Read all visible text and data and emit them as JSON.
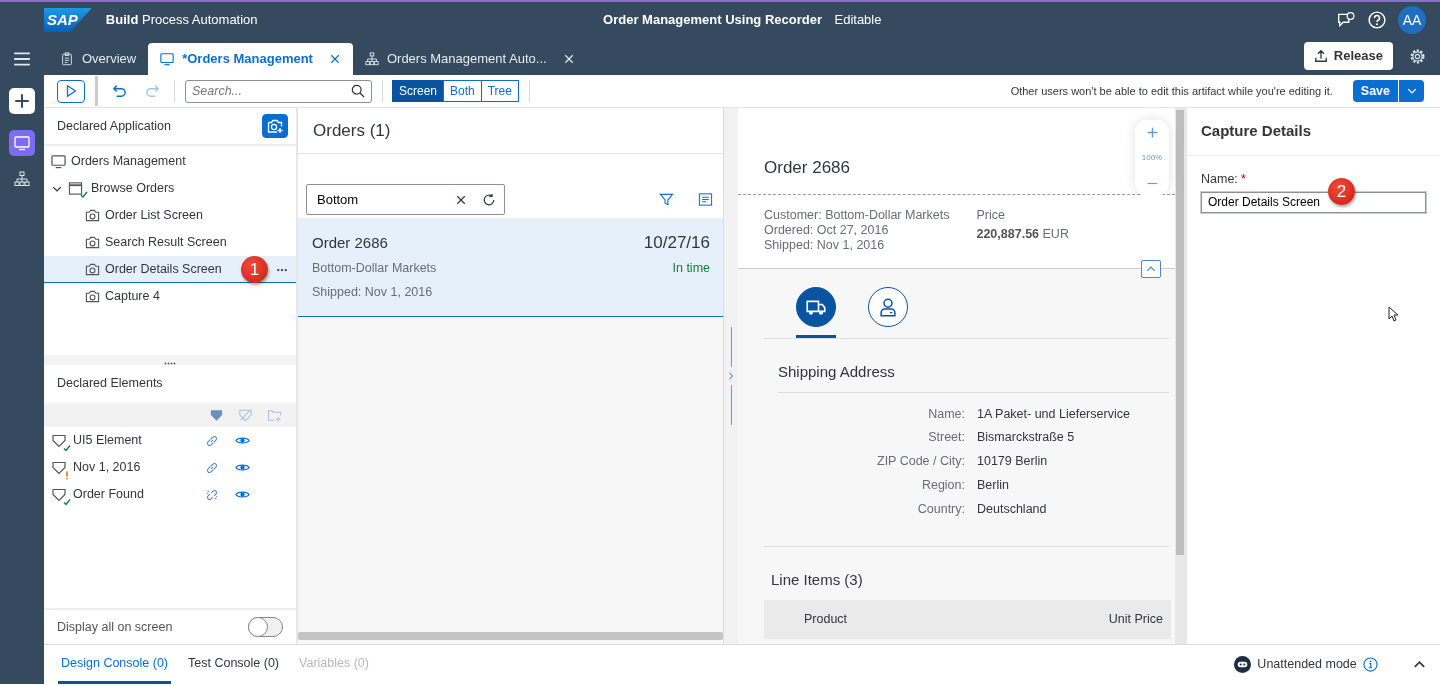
{
  "shell": {
    "logo": "SAP",
    "product_bold": "Build",
    "product": "Process Automation",
    "title": "Order Management Using Recorder",
    "state": "Editable",
    "avatar": "AA"
  },
  "tabs": [
    {
      "label": "Overview",
      "selected": false,
      "closable": false
    },
    {
      "label": "*Orders Management",
      "selected": true,
      "closable": true
    },
    {
      "label": "Orders Management Auto...",
      "selected": false,
      "closable": true
    }
  ],
  "release_button": "Release",
  "rail": [
    {
      "selected": true
    },
    {
      "selected": false
    }
  ],
  "toolbar": {
    "redo_disabled": true,
    "search_placeholder": "Search...",
    "view_modes": [
      {
        "label": "Screen",
        "selected": true
      },
      {
        "label": "Both",
        "selected": false
      },
      {
        "label": "Tree",
        "selected": false
      }
    ],
    "notice": "Other users won't be able to edit this artifact while you're editing it.",
    "save_button": "Save"
  },
  "declared_application": {
    "title": "Declared Application",
    "tree": [
      {
        "label": "Orders Management",
        "kind": "application",
        "selected": false
      },
      {
        "label": "Browse Orders",
        "kind": "page",
        "validated": true,
        "expanded": true,
        "selected": false,
        "children": [
          {
            "label": "Order List Screen",
            "kind": "screen",
            "selected": false
          },
          {
            "label": "Search Result Screen",
            "kind": "screen",
            "selected": false
          },
          {
            "label": "Order Details Screen",
            "kind": "screen",
            "selected": true,
            "marker": "1"
          },
          {
            "label": "Capture 4",
            "kind": "screen",
            "selected": false
          }
        ]
      }
    ]
  },
  "declared_elements": {
    "title": "Declared Elements",
    "rows": [
      {
        "label": "UI5 Element",
        "warning": false,
        "broken_link": false
      },
      {
        "label": "Nov 1, 2016",
        "warning": true,
        "broken_link": false
      },
      {
        "label": "Order Found",
        "warning": false,
        "broken_link": true
      }
    ]
  },
  "display_all": {
    "label": "Display all on screen",
    "on": false
  },
  "orders": {
    "title": "Orders (1)",
    "search_value": "Bottom",
    "items": [
      {
        "title": "Order 2686",
        "date": "10/27/16",
        "customer": "Bottom-Dollar Markets",
        "status": "In time",
        "shipped": "Shipped: Nov 1, 2016",
        "selected": true
      }
    ]
  },
  "detail": {
    "title": "Order 2686",
    "zoom": "100%",
    "customer": "Customer: Bottom-Dollar Markets",
    "ordered": "Ordered: Oct 27, 2016",
    "shipped": "Shipped: Nov 1, 2016",
    "price_label": "Price",
    "price_value": "220,887.56",
    "currency": "EUR",
    "icon_tabs": [
      {
        "selected": true
      },
      {
        "selected": false
      }
    ],
    "section_title": "Shipping Address",
    "fields": [
      {
        "label": "Name:",
        "value": "1A Paket- und Lieferservice"
      },
      {
        "label": "Street:",
        "value": "Bismarckstraße 5"
      },
      {
        "label": "ZIP Code / City:",
        "value": "10179 Berlin"
      },
      {
        "label": "Region:",
        "value": "Berlin"
      },
      {
        "label": "Country:",
        "value": "Deutschland"
      }
    ],
    "line_items_title": "Line Items (3)",
    "columns": [
      "Product",
      "Unit Price"
    ]
  },
  "capture": {
    "title": "Capture Details",
    "label": "Name:",
    "required_mark": "*",
    "value": "Order Details Screen",
    "marker": "2"
  },
  "bottom": {
    "tabs": [
      {
        "label": "Design Console (0)",
        "selected": true,
        "disabled": false
      },
      {
        "label": "Test Console (0)",
        "selected": false,
        "disabled": false
      },
      {
        "label": "Variables (0)",
        "selected": false,
        "disabled": true
      }
    ],
    "mode": "Unattended mode"
  }
}
